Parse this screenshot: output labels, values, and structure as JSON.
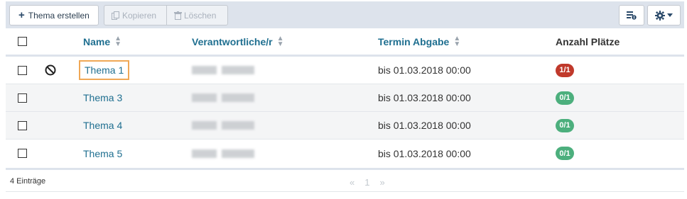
{
  "toolbar": {
    "create_label": "Thema erstellen",
    "copy_label": "Kopieren",
    "delete_label": "Löschen"
  },
  "table": {
    "columns": {
      "name": "Name",
      "responsible": "Verantwortliche/r",
      "deadline": "Termin Abgabe",
      "seats": "Anzahl Plätze"
    },
    "rows": [
      {
        "name": "Thema 1",
        "deadline": "bis 01.03.2018 00:00",
        "seats": "1/1",
        "seats_color": "#c0392b",
        "blocked": true
      },
      {
        "name": "Thema 3",
        "deadline": "bis 01.03.2018 00:00",
        "seats": "0/1",
        "seats_color": "#4caf7d",
        "blocked": false
      },
      {
        "name": "Thema 4",
        "deadline": "bis 01.03.2018 00:00",
        "seats": "0/1",
        "seats_color": "#4caf7d",
        "blocked": false
      },
      {
        "name": "Thema 5",
        "deadline": "bis 01.03.2018 00:00",
        "seats": "0/1",
        "seats_color": "#4caf7d",
        "blocked": false
      }
    ]
  },
  "footer": {
    "count": "4 Einträge",
    "prev": "«",
    "page": "1",
    "next": "»"
  },
  "colors": {
    "accent": "#1f6f90",
    "full": "#c0392b",
    "available": "#4caf7d",
    "focus": "#f0a856"
  }
}
